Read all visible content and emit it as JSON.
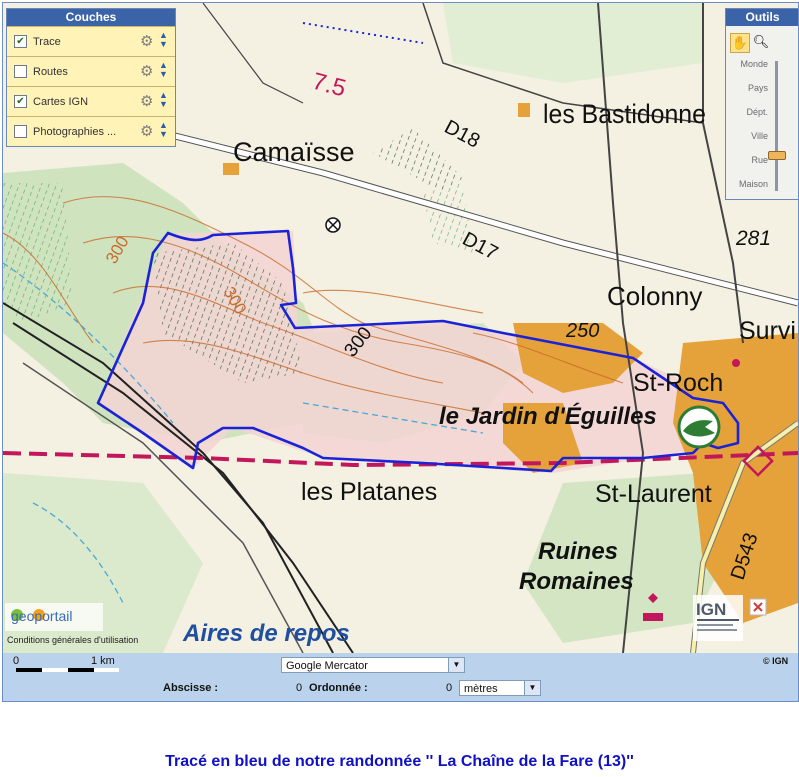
{
  "layers_panel": {
    "title": "Couches",
    "items": [
      {
        "label": "Trace",
        "checked": true
      },
      {
        "label": "Routes",
        "checked": false
      },
      {
        "label": "Cartes IGN",
        "checked": true
      },
      {
        "label": "Photographies ...",
        "checked": false
      }
    ]
  },
  "tools_panel": {
    "title": "Outils",
    "zoom_levels": [
      "Monde",
      "Pays",
      "Dépt.",
      "Ville",
      "Rue",
      "Maison"
    ],
    "current_zoom": "Rue"
  },
  "map": {
    "labels": {
      "bastidonne": "les Bastidonne",
      "camaisse": "Camaïsse",
      "d18": "D18",
      "d17": "D17",
      "n281": "281",
      "colonny": "Colonny",
      "n250": "250",
      "survi": "Survi",
      "stroch": "St-Roch",
      "jardin": "le Jardin d'Éguilles",
      "platanes": "les Platanes",
      "stlaurent": "St-Laurent",
      "ruines": "Ruines",
      "romaines": "Romaines",
      "d543": "D543",
      "aires": "Aires de repos",
      "c300a": "300",
      "c300b": "300",
      "c300c": "300",
      "r75": "7.5"
    },
    "geoportail_logo": "geoportail",
    "conditions_text": "Conditions générales d'utilisation",
    "ign_logo": "IGN",
    "colors": {
      "track": "#1a23d6",
      "urban": "#e6a23a",
      "contour": "#c96b2a",
      "road_red": "#c2185b"
    }
  },
  "bottom_bar": {
    "scale_start": "0",
    "scale_end": "1 km",
    "projection": "Google Mercator",
    "copyright": "© IGN",
    "abscisse_label": "Abscisse :",
    "abscisse_value": "0",
    "ordonnee_label": "Ordonnée :",
    "ordonnee_value": "0",
    "unit": "mètres"
  },
  "caption": "Tracé en bleu de notre randonnée '' La Chaîne de la Fare (13)''"
}
